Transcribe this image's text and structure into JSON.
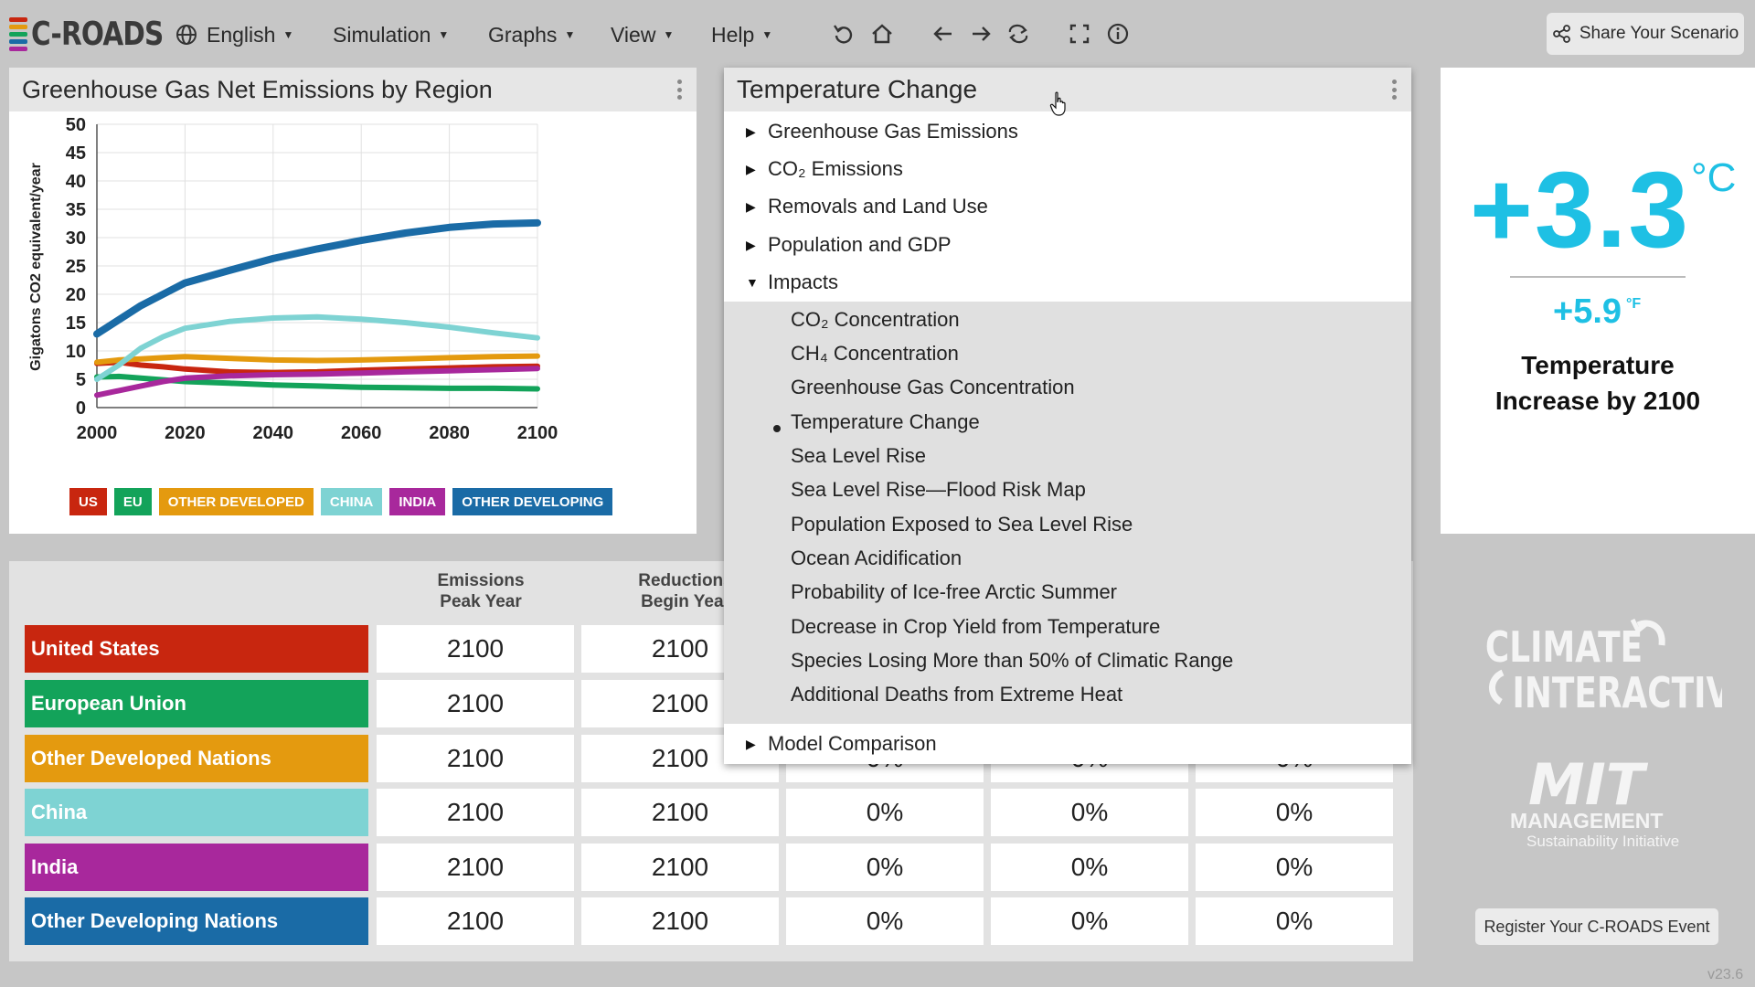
{
  "header": {
    "app_name": "C-ROADS",
    "language": "English",
    "menus": [
      "Simulation",
      "Graphs",
      "View",
      "Help"
    ],
    "tools": [
      "undo-icon",
      "home-icon",
      "back-arrow-icon",
      "forward-arrow-icon",
      "redo-icon",
      "fullscreen-icon",
      "info-icon"
    ],
    "share_label": "Share Your Scenario"
  },
  "colors": {
    "us": "#c8260f",
    "eu": "#13a35a",
    "other_developed": "#e49a0f",
    "china": "#7ed3d3",
    "india": "#a8289c",
    "other_developing": "#1a6ba6",
    "accent": "#1ec0e4"
  },
  "chart_panel": {
    "title": "Greenhouse Gas Net Emissions by Region"
  },
  "chart_data": {
    "type": "line",
    "title": "Greenhouse Gas Net Emissions by Region",
    "xlabel": "",
    "ylabel": "Gigatons CO2 equivalent/year",
    "xlim": [
      2000,
      2100
    ],
    "ylim": [
      0,
      50
    ],
    "x_ticks": [
      2000,
      2020,
      2040,
      2060,
      2080,
      2100
    ],
    "y_ticks": [
      0,
      5,
      10,
      15,
      20,
      25,
      30,
      35,
      40,
      45,
      50
    ],
    "grid": true,
    "legend_position": "bottom",
    "x": [
      2000,
      2005,
      2010,
      2015,
      2020,
      2030,
      2040,
      2050,
      2060,
      2070,
      2080,
      2090,
      2100
    ],
    "series": [
      {
        "name": "US",
        "color": "#c8260f",
        "values": [
          7.8,
          8.0,
          7.5,
          7.2,
          6.8,
          6.3,
          6.2,
          6.3,
          6.6,
          6.8,
          7.0,
          7.2,
          7.3
        ]
      },
      {
        "name": "EU",
        "color": "#13a35a",
        "values": [
          5.4,
          5.5,
          5.2,
          4.9,
          4.6,
          4.3,
          4.0,
          3.8,
          3.6,
          3.5,
          3.4,
          3.4,
          3.3
        ]
      },
      {
        "name": "OTHER DEVELOPED",
        "color": "#e49a0f",
        "values": [
          8.0,
          8.4,
          8.6,
          8.8,
          9.0,
          8.7,
          8.4,
          8.3,
          8.4,
          8.6,
          8.8,
          9.0,
          9.1
        ]
      },
      {
        "name": "CHINA",
        "color": "#7ed3d3",
        "values": [
          5.0,
          7.5,
          10.5,
          12.5,
          14.0,
          15.2,
          15.8,
          16.0,
          15.6,
          15.0,
          14.2,
          13.2,
          12.3
        ]
      },
      {
        "name": "INDIA",
        "color": "#a8289c",
        "values": [
          2.2,
          3.0,
          3.8,
          4.6,
          5.2,
          5.6,
          5.8,
          5.9,
          6.1,
          6.3,
          6.5,
          6.7,
          6.9
        ]
      },
      {
        "name": "OTHER DEVELOPING",
        "color": "#1a6ba6",
        "values": [
          13.0,
          15.5,
          18.0,
          20.0,
          22.0,
          24.2,
          26.3,
          28.0,
          29.5,
          30.8,
          31.8,
          32.4,
          32.6
        ]
      }
    ]
  },
  "legend": [
    {
      "label": "US",
      "color": "#c8260f"
    },
    {
      "label": "EU",
      "color": "#13a35a"
    },
    {
      "label": "OTHER DEVELOPED",
      "color": "#e49a0f"
    },
    {
      "label": "CHINA",
      "color": "#7ed3d3"
    },
    {
      "label": "INDIA",
      "color": "#a8289c"
    },
    {
      "label": "OTHER DEVELOPING",
      "color": "#1a6ba6"
    }
  ],
  "table": {
    "headers": [
      "Emissions\nPeak Year",
      "Reductions\nBegin Year"
    ],
    "rows": [
      {
        "name": "United States",
        "color": "#c8260f",
        "cells": [
          "2100",
          "2100",
          "",
          "",
          ""
        ]
      },
      {
        "name": "European Union",
        "color": "#13a35a",
        "cells": [
          "2100",
          "2100",
          "",
          "",
          ""
        ]
      },
      {
        "name": "Other Developed Nations",
        "color": "#e49a0f",
        "cells": [
          "2100",
          "2100",
          "0%",
          "0%",
          "0%"
        ]
      },
      {
        "name": "China",
        "color": "#7ed3d3",
        "cells": [
          "2100",
          "2100",
          "0%",
          "0%",
          "0%"
        ]
      },
      {
        "name": "India",
        "color": "#a8289c",
        "cells": [
          "2100",
          "2100",
          "0%",
          "0%",
          "0%"
        ]
      },
      {
        "name": "Other Developing Nations",
        "color": "#1a6ba6",
        "cells": [
          "2100",
          "2100",
          "0%",
          "0%",
          "0%"
        ]
      }
    ]
  },
  "dropdown": {
    "title": "Temperature Change",
    "categories": [
      {
        "label": "Greenhouse Gas Emissions",
        "expanded": false
      },
      {
        "label": "CO₂ Emissions",
        "expanded": false
      },
      {
        "label": "Removals and Land Use",
        "expanded": false
      },
      {
        "label": "Population and GDP",
        "expanded": false
      },
      {
        "label": "Impacts",
        "expanded": true
      }
    ],
    "impact_items": [
      "CO₂ Concentration",
      "CH₄ Concentration",
      "Greenhouse Gas Concentration",
      "Temperature Change",
      "Sea Level Rise",
      "Sea Level Rise—Flood Risk Map",
      "Population Exposed to Sea Level Rise",
      "Ocean Acidification",
      "Probability of Ice-free Arctic Summer",
      "Decrease in Crop Yield from Temperature",
      "Species Losing More than 50% of Climatic Range",
      "Additional Deaths from Extreme Heat"
    ],
    "selected_item": "Temperature Change",
    "footer_category": "Model Comparison"
  },
  "temperature": {
    "celsius": "+3.3",
    "celsius_unit": "°C",
    "fahrenheit": "+5.9",
    "fahrenheit_unit": "°F",
    "caption": "Temperature Increase by 2100"
  },
  "branding": {
    "climate_interactive": [
      "CLIMATE",
      "INTERACTIVE"
    ],
    "mit": [
      "MIT",
      "MANAGEMENT",
      "Sustainability Initiative"
    ]
  },
  "register_label": "Register Your C-ROADS Event",
  "version": "v23.6"
}
